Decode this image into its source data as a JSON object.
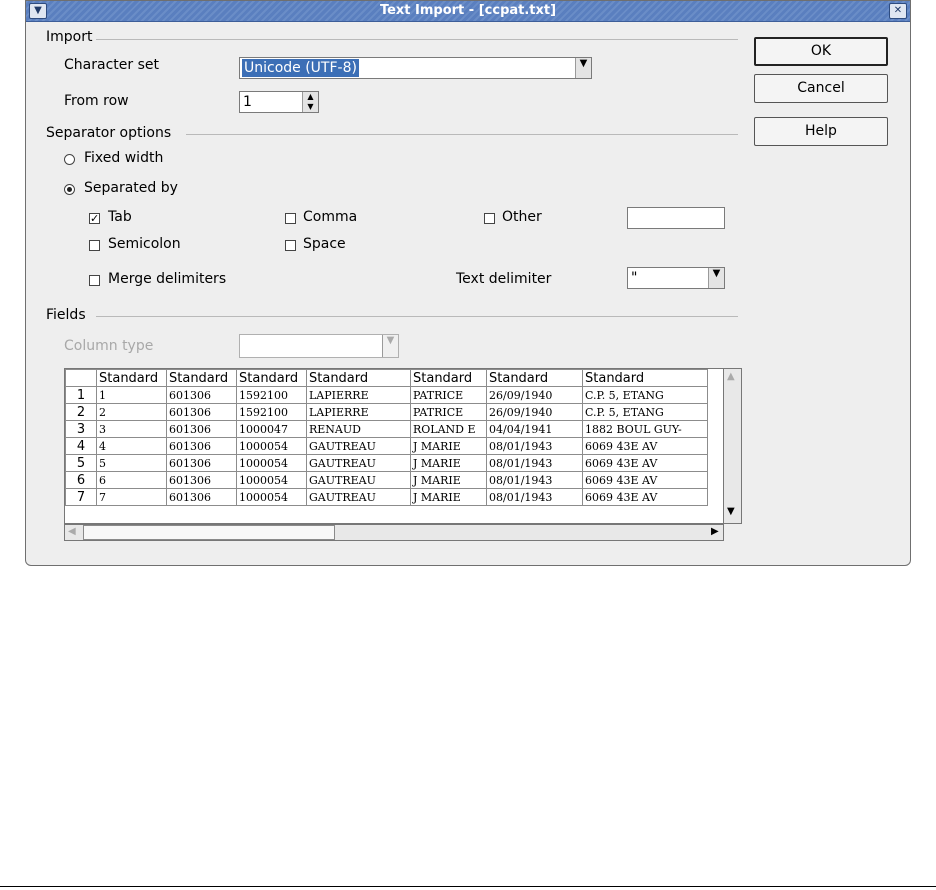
{
  "window": {
    "title": "Text Import - [ccpat.txt]",
    "menu_icon": "chevron-down-icon",
    "close_icon": "close-icon"
  },
  "import": {
    "section_label": "Import",
    "charset_label": "Character set",
    "charset_value": "Unicode (UTF-8)",
    "fromrow_label": "From row",
    "fromrow_value": "1"
  },
  "separator": {
    "section_label": "Separator options",
    "fixed_width": "Fixed width",
    "separated_by": "Separated by",
    "tab": "Tab",
    "comma": "Comma",
    "other": "Other",
    "semicolon": "Semicolon",
    "space": "Space",
    "merge": "Merge delimiters",
    "text_delim_label": "Text delimiter",
    "text_delim_value": "\"",
    "other_value": "",
    "state": {
      "fixed_width": false,
      "separated_by": true,
      "tab": true,
      "comma": false,
      "other": false,
      "semicolon": false,
      "space": false,
      "merge": false
    }
  },
  "fields": {
    "section_label": "Fields",
    "column_type_label": "Column type",
    "column_type_value": "",
    "headers": [
      "Standard",
      "Standard",
      "Standard",
      "Standard",
      "Standard",
      "Standard",
      "Standard"
    ],
    "rows": [
      {
        "n": "1",
        "c": [
          "1",
          "601306",
          "1592100",
          "LAPIERRE",
          "PATRICE",
          "26/09/1940",
          "C.P. 5, ETANG"
        ]
      },
      {
        "n": "2",
        "c": [
          "2",
          "601306",
          "1592100",
          "LAPIERRE",
          "PATRICE",
          "26/09/1940",
          "C.P. 5, ETANG"
        ]
      },
      {
        "n": "3",
        "c": [
          "3",
          "601306",
          "1000047",
          "RENAUD",
          "ROLAND E",
          "04/04/1941",
          "1882 BOUL GUY-"
        ]
      },
      {
        "n": "4",
        "c": [
          "4",
          "601306",
          "1000054",
          "GAUTREAU",
          "J MARIE",
          "08/01/1943",
          "6069 43E AV"
        ]
      },
      {
        "n": "5",
        "c": [
          "5",
          "601306",
          "1000054",
          "GAUTREAU",
          "J MARIE",
          "08/01/1943",
          "6069 43E AV"
        ]
      },
      {
        "n": "6",
        "c": [
          "6",
          "601306",
          "1000054",
          "GAUTREAU",
          "J MARIE",
          "08/01/1943",
          "6069 43E AV"
        ]
      },
      {
        "n": "7",
        "c": [
          "7",
          "601306",
          "1000054",
          "GAUTREAU",
          "J MARIE",
          "08/01/1943",
          "6069 43E AV"
        ]
      }
    ]
  },
  "buttons": {
    "ok": "OK",
    "cancel": "Cancel",
    "help": "Help"
  }
}
